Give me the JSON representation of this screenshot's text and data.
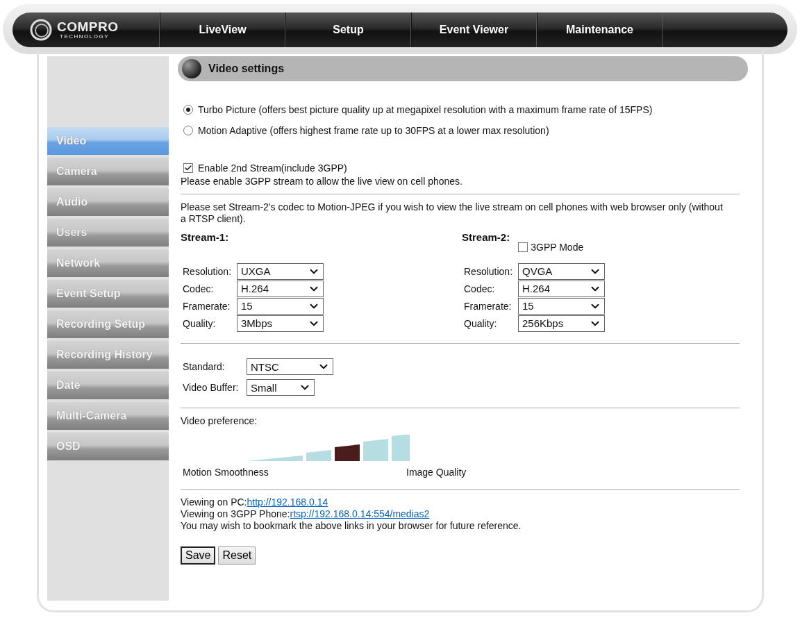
{
  "logo": {
    "name": "COMPRO",
    "tagline": "TECHNOLOGY"
  },
  "nav": [
    "LiveView",
    "Setup",
    "Event Viewer",
    "Maintenance"
  ],
  "sidebar": [
    {
      "label": "Video",
      "selected": true
    },
    {
      "label": "Camera",
      "selected": false
    },
    {
      "label": "Audio",
      "selected": false
    },
    {
      "label": "Users",
      "selected": false
    },
    {
      "label": "Network",
      "selected": false
    },
    {
      "label": "Event Setup",
      "selected": false
    },
    {
      "label": "Recording Setup",
      "selected": false
    },
    {
      "label": "Recording History",
      "selected": false
    },
    {
      "label": "Date",
      "selected": false
    },
    {
      "label": "Multi-Camera",
      "selected": false
    },
    {
      "label": "OSD",
      "selected": false
    }
  ],
  "section_title": "Video settings",
  "modes": [
    {
      "label": "Turbo Picture (offers best picture quality up at megapixel resolution with a maximum frame rate of 15FPS)",
      "selected": true
    },
    {
      "label": "Motion Adaptive (offers highest frame rate up to 30FPS at a lower max resolution)",
      "selected": false
    }
  ],
  "second_stream": {
    "label": "Enable 2nd Stream(include 3GPP)",
    "checked": true,
    "note": "Please enable 3GPP stream to allow the live view on cell phones."
  },
  "codec_note": "Please set Stream-2's codec to Motion-JPEG if you wish to view the live stream on cell phones with web browser only (without a RTSP client).",
  "streams": [
    {
      "title": "Stream-1:",
      "fields": [
        {
          "label": "Resolution:",
          "value": "UXGA"
        },
        {
          "label": "Codec:",
          "value": "H.264"
        },
        {
          "label": "Framerate:",
          "value": "15"
        },
        {
          "label": "Quality:",
          "value": "3Mbps"
        }
      ]
    },
    {
      "title": "Stream-2:",
      "mode": {
        "label": "3GPP Mode",
        "checked": false
      },
      "fields": [
        {
          "label": "Resolution:",
          "value": "QVGA"
        },
        {
          "label": "Codec:",
          "value": "H.264"
        },
        {
          "label": "Framerate:",
          "value": "15"
        },
        {
          "label": "Quality:",
          "value": "256Kbps"
        }
      ]
    }
  ],
  "general": [
    {
      "label": "Standard:",
      "value": "NTSC"
    },
    {
      "label": "Video Buffer:",
      "value": "Small"
    }
  ],
  "preference": {
    "label": "Video preference:",
    "left": "Motion Smoothness",
    "right": "Image Quality",
    "steps": [
      {
        "selected": false
      },
      {
        "selected": false
      },
      {
        "selected": true
      },
      {
        "selected": false
      },
      {
        "selected": false
      }
    ]
  },
  "links": [
    {
      "label": "Viewing on PC:",
      "url": "http://192.168.0.14"
    },
    {
      "label": "Viewing on 3GPP Phone:",
      "url": "rtsp://192.168.0.14:554/medias2"
    }
  ],
  "bookmark_note": "You may wish to bookmark the above links in your browser for future reference.",
  "buttons": [
    {
      "label": "Save",
      "focused": true
    },
    {
      "label": "Reset",
      "focused": false
    }
  ]
}
